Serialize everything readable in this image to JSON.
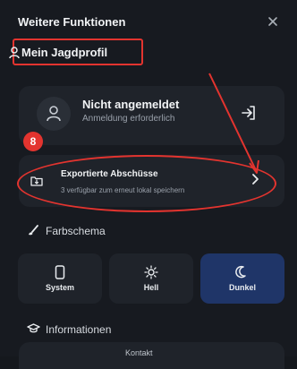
{
  "header": {
    "title": "Weitere Funktionen"
  },
  "profile": {
    "label": "Mein Jagdprofil"
  },
  "login": {
    "title": "Nicht angemeldet",
    "subtitle": "Anmeldung erforderlich"
  },
  "annotation": {
    "badge": "8"
  },
  "export": {
    "title": "Exportierte Abschüsse",
    "subtitle": "3 verfügbar zum erneut lokal speichern"
  },
  "theme": {
    "section_label": "Farbschema",
    "options": [
      {
        "label": "System"
      },
      {
        "label": "Hell"
      },
      {
        "label": "Dunkel",
        "selected": true
      }
    ]
  },
  "info": {
    "section_label": "Informationen",
    "first_item": "Kontakt"
  },
  "colors": {
    "background": "#171a20",
    "card": "#1f232a",
    "accent_selected": "#1f3568",
    "annotation_red": "#e3342f"
  }
}
